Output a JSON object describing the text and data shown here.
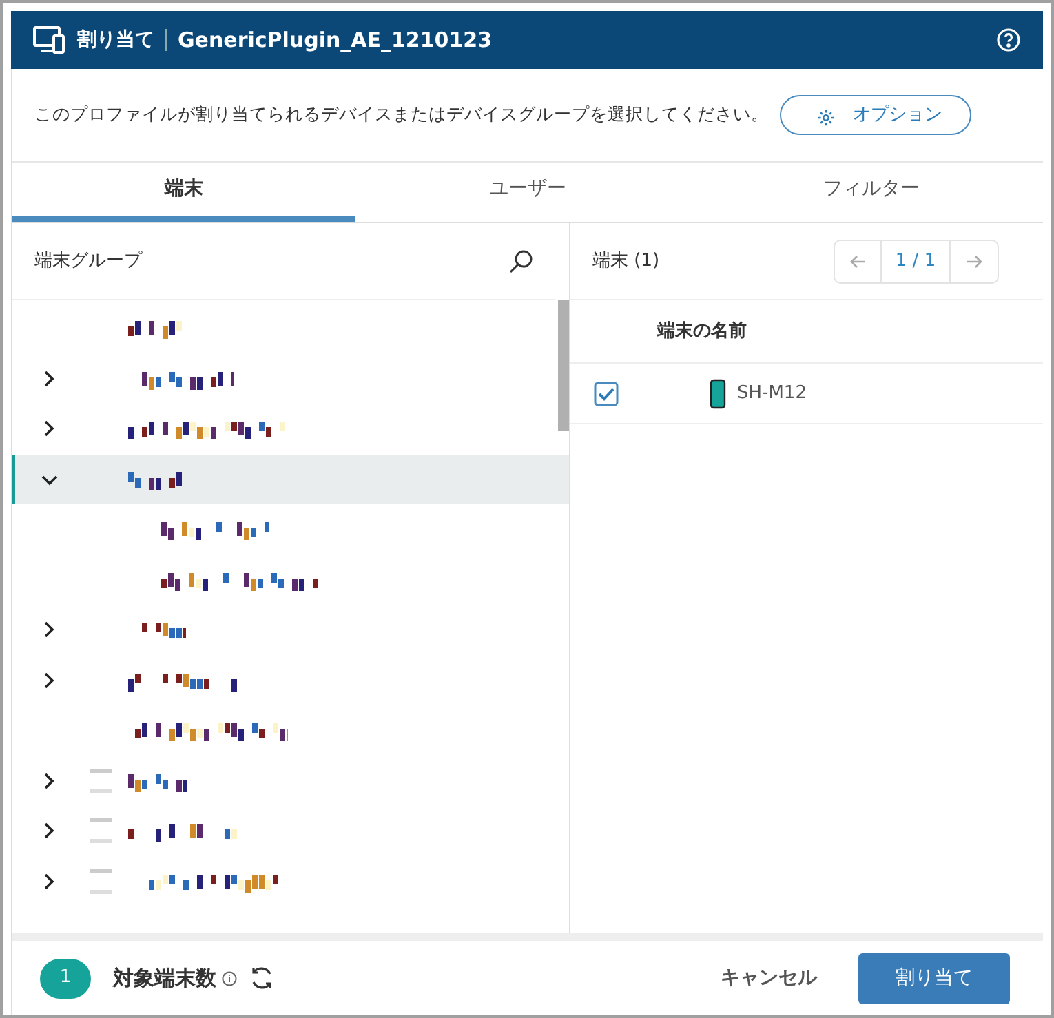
{
  "window": {
    "title": "割り当て",
    "subtitle": "GenericPlugin_AE_1210123"
  },
  "description": "このプロファイルが割り当てられるデバイスまたはデバイスグループを選択してください。",
  "options_button": "オプション",
  "tabs": [
    {
      "label": "端末",
      "selected": true
    },
    {
      "label": "ユーザー",
      "selected": false
    },
    {
      "label": "フィルター",
      "selected": false
    }
  ],
  "tree": {
    "title": "端末グループ",
    "items": [
      {
        "kind": "plain",
        "selected": false
      },
      {
        "kind": "plain",
        "expanded": false,
        "selected": false
      },
      {
        "kind": "plain",
        "expanded": false,
        "selected": false
      },
      {
        "kind": "plain",
        "expanded": true,
        "selected": true,
        "children": [
          {
            "kind": "plain",
            "selected": false
          },
          {
            "kind": "plain",
            "selected": false
          }
        ]
      },
      {
        "kind": "plain",
        "expanded": false,
        "selected": false
      },
      {
        "kind": "plain",
        "expanded": false,
        "selected": false
      },
      {
        "kind": "plain",
        "selected": false
      },
      {
        "kind": "icon",
        "expanded": false,
        "selected": false
      },
      {
        "kind": "icon",
        "expanded": false,
        "selected": false
      },
      {
        "kind": "icon",
        "expanded": false,
        "selected": false
      }
    ]
  },
  "devices": {
    "title": "端末",
    "count": "(1)",
    "pager": "1 / 1",
    "column": "端末の名前",
    "rows": [
      {
        "name": "SH-M12",
        "checked": true
      }
    ]
  },
  "footer": {
    "count": "1",
    "label": "対象端末数",
    "cancel": "キャンセル",
    "assign": "割り当て"
  }
}
